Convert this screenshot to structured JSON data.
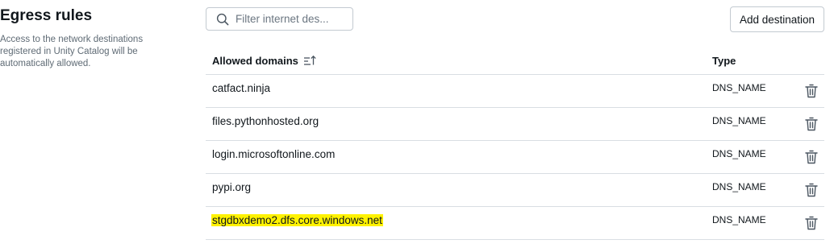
{
  "egress": {
    "title": "Egress rules",
    "description": "Access to the network destinations registered in Unity Catalog will be automatically allowed."
  },
  "filter": {
    "placeholder": "Filter internet des...",
    "value": ""
  },
  "toolbar": {
    "add_label": "Add destination"
  },
  "table": {
    "columns": {
      "domain": "Allowed domains",
      "type": "Type"
    },
    "sort": "ascending",
    "rows": [
      {
        "domain": "catfact.ninja",
        "type": "DNS_NAME"
      },
      {
        "domain": "files.pythonhosted.org",
        "type": "DNS_NAME"
      },
      {
        "domain": "login.microsoftonline.com",
        "type": "DNS_NAME"
      },
      {
        "domain": "pypi.org",
        "type": "DNS_NAME"
      },
      {
        "domain": "stgdbxdemo2.dfs.core.windows.net",
        "type": "DNS_NAME",
        "highlighted": true
      }
    ]
  },
  "icons": {
    "search": "search-icon",
    "sort": "sort-ascending-icon",
    "delete": "trash-icon"
  },
  "colors": {
    "highlight": "#fff200",
    "border": "#d9dee3",
    "icon": "#4a5560"
  }
}
